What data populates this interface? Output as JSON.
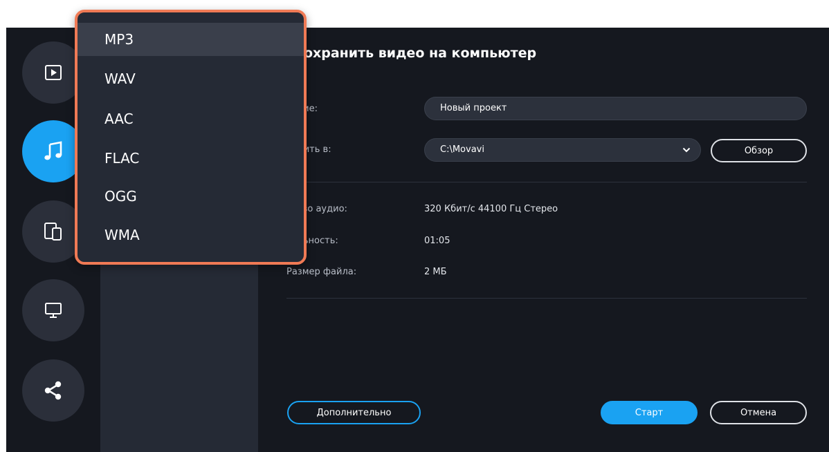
{
  "app": {
    "heading": "Сохранить видео на компьютер"
  },
  "sidebar": {
    "items": [
      {
        "name": "video",
        "icon": "play-icon",
        "active": false
      },
      {
        "name": "audio",
        "icon": "music-note-icon",
        "active": true
      },
      {
        "name": "devices",
        "icon": "devices-icon",
        "active": false
      },
      {
        "name": "tv",
        "icon": "monitor-icon",
        "active": false
      },
      {
        "name": "share",
        "icon": "share-icon",
        "active": false
      }
    ]
  },
  "format_dropdown": {
    "selected": "MP3",
    "options": [
      "MP3",
      "WAV",
      "AAC",
      "FLAC",
      "OGG",
      "WMA"
    ]
  },
  "form": {
    "name_label": "вание:",
    "name_value": "Новый проект",
    "save_to_label": "ранить в:",
    "save_to_value": "C:\\Movavi",
    "browse_label": "Обзор"
  },
  "info": {
    "quality_label": "ество аудио:",
    "quality_value": "320 Кбит/с 44100 Гц Стерео",
    "duration_label": "тельность:",
    "duration_value": "01:05",
    "size_label": "Размер файла:",
    "size_value": "2 МБ"
  },
  "footer": {
    "advanced_label": "Дополнительно",
    "start_label": "Старт",
    "cancel_label": "Отмена"
  },
  "colors": {
    "accent": "#1aa2f2",
    "highlight_border": "#f07a55",
    "background": "#15181f",
    "panel": "#252a35"
  }
}
